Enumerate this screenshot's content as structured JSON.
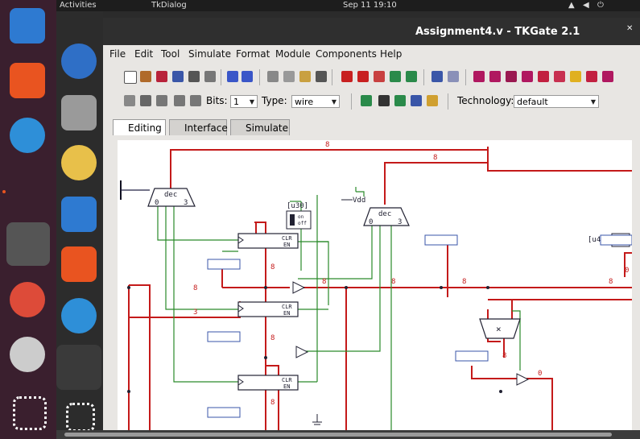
{
  "topbar": {
    "activities": "Activities",
    "app": "TkDialog",
    "clock": "Sep 11 19:10"
  },
  "window": {
    "title": "Assignment4.v - TKGate 2.1"
  },
  "menu": [
    "File",
    "Edit",
    "Tool",
    "Simulate",
    "Format",
    "Module",
    "Components",
    "Help"
  ],
  "toolbar2": {
    "bits_label": "Bits:",
    "bits_value": "1",
    "type_label": "Type:",
    "type_value": "wire",
    "technology_label": "Technology:",
    "technology_value": "default"
  },
  "tabs": [
    {
      "label": "Editing",
      "active": true
    },
    {
      "label": "Interface",
      "active": false
    },
    {
      "label": "Simulate",
      "active": false
    }
  ],
  "circuit": {
    "dec1": "dec",
    "dec1_0": "0",
    "dec1_3": "3",
    "dec2": "dec",
    "dec2_0": "0",
    "dec2_3": "3",
    "vdd": "Vdd",
    "u30": "[u30]",
    "u42": "[u42]",
    "sw_on": "on",
    "sw_off": "off",
    "clk": "CLR",
    "en": "EN",
    "w8": "8",
    "w3": "3",
    "w0": "0",
    "mul": "×"
  }
}
